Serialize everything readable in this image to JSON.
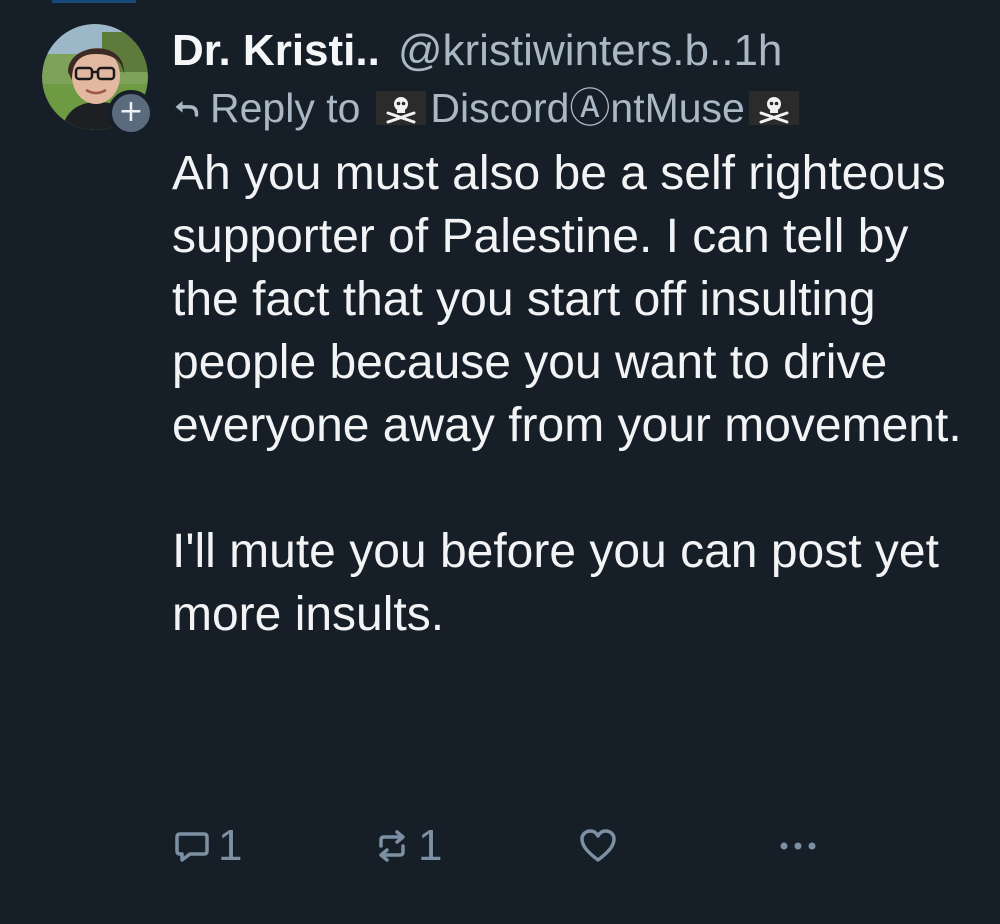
{
  "post": {
    "author_name": "Dr. Kristi..",
    "author_handle": "@kristiwinters.b..",
    "time": "1h",
    "reply_label": "Reply to",
    "reply_target": "DiscordⒶntMuse",
    "body": "Ah you must also be a self righteous supporter of Palestine. I can tell by the fact that you start off insulting people because you want to drive everyone away from your movement.\n\nI'll mute you before you can post yet more insults.",
    "reply_count": "1",
    "repost_count": "1"
  },
  "colors": {
    "background": "#161e27",
    "text_primary": "#f1f3f5",
    "text_secondary": "#aab8c6",
    "icon": "#7d8fa3"
  },
  "icons": {
    "reply": "speech-bubble-icon",
    "repost": "repost-arrows-icon",
    "like": "heart-icon",
    "more": "ellipsis-icon",
    "follow": "plus-icon",
    "flag": "pirate-flag-icon"
  }
}
